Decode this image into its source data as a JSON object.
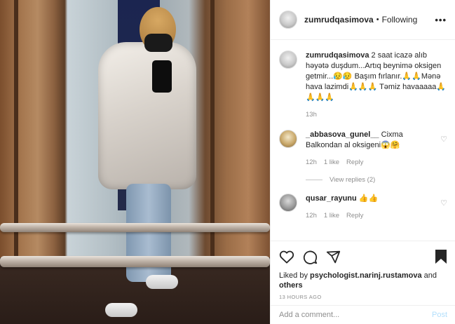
{
  "header": {
    "username": "zumrudqasimova",
    "separator": "•",
    "follow_status": "Following",
    "more": "•••"
  },
  "caption": {
    "username": "zumrudqasimova",
    "text": "2 saat icazə alıb həyətə duşdum...Artıq beynimə oksigen getmir...😥😥 Başım fırlanır.🙏🙏Mənə hava lazimdi🙏🙏🙏 Təmiz havaaaaa🙏🙏🙏🙏",
    "time": "13h"
  },
  "comments": [
    {
      "username": "_abbasova_gunel__",
      "text": "Cixma Balkondan al oksigeni😱🤗",
      "time": "12h",
      "likes": "1 like",
      "reply": "Reply"
    },
    {
      "username": "qusar_rayunu",
      "text": "👍👍",
      "time": "12h",
      "likes": "1 like",
      "reply": "Reply"
    }
  ],
  "view_replies": "View replies (2)",
  "likes": {
    "prefix": "Liked by",
    "user": "psychologist.narinj.rustamova",
    "and": "and",
    "others": "others"
  },
  "timestamp": "13 HOURS AGO",
  "add_comment": {
    "placeholder": "Add a comment...",
    "post": "Post"
  },
  "icons": {
    "like": "heart-icon",
    "comment": "comment-icon",
    "share": "share-icon",
    "save": "bookmark-icon"
  }
}
